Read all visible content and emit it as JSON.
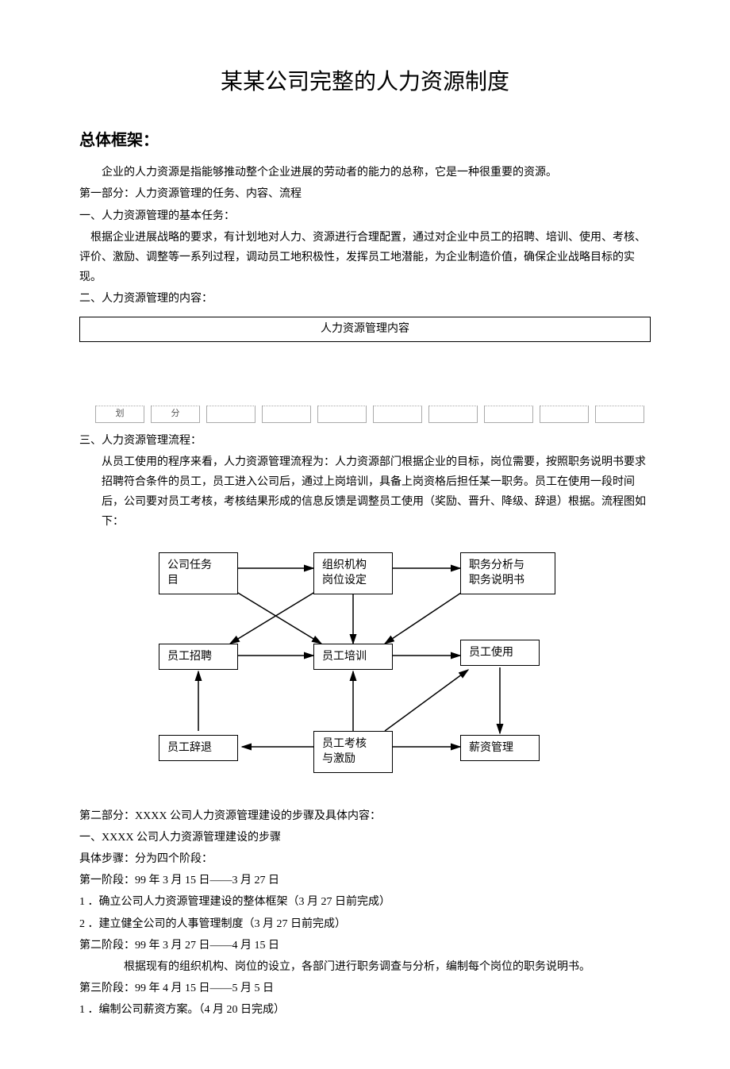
{
  "title": "某某公司完整的人力资源制度",
  "h_framework": "总体框架：",
  "intro": "企业的人力资源是指能够推动整个企业进展的劳动者的能力的总称，它是一种很重要的资源。",
  "part1": "第一部分：人力资源管理的任务、内容、流程",
  "sec1": "一、人力资源管理的基本任务：",
  "sec1_body": "根据企业进展战略的要求，有计划地对人力、资源进行合理配置，通过对企业中员工的招聘、培训、使用、考核、评价、激励、调整等一系列过程，调动员工地积极性，发挥员工地潜能，为企业制造价值，确保企业战略目标的实现。",
  "sec2": "二、人力资源管理的内容：",
  "table_header": "人力资源管理内容",
  "small_boxes": [
    "划",
    "分",
    "",
    "",
    "",
    "",
    "",
    "",
    "",
    ""
  ],
  "sec3": "三、人力资源管理流程：",
  "sec3_p1": "从员工使用的程序来看，人力资源管理流程为：人力资源部门根据企业的目标，岗位需要，按照职务说明书要求招聘符合条件的员工，员工进入公司后，通过上岗培训，具备上岗资格后担任某一职务。员工在使用一段时间后，公司要对员工考核，考核结果形成的信息反馈是调整员工使用（奖励、晋升、降级、辞退）根据。流程图如下：",
  "flow": {
    "b1": "公司任务\n目",
    "b2": "组织机构\n岗位设定",
    "b3": "职务分析与\n职务说明书",
    "b4": "员工招聘",
    "b5": "员工培训",
    "b6": "员工使用",
    "b7": "员工辞退",
    "b8": "员工考核\n与激励",
    "b9": "薪资管理"
  },
  "part2": "第二部分：XXXX 公司人力资源管理建设的步骤及具体内容：",
  "p2_sec1": "一、XXXX 公司人力资源管理建设的步骤",
  "p2_steps_intro": "具体步骤：分为四个阶段：",
  "phase1": "第一阶段：99 年 3 月 15 日——3 月 27 日",
  "phase1_1": "1 ．确立公司人力资源管理建设的整体框架（3 月 27 日前完成）",
  "phase1_2": "2 ．建立健全公司的人事管理制度（3 月 27 日前完成）",
  "phase2": "第二阶段：99 年 3 月 27 日——4 月 15 日",
  "phase2_body": "根据现有的组织机构、岗位的设立，各部门进行职务调查与分析，编制每个岗位的职务说明书。",
  "phase3": "第三阶段：99 年 4 月 15 日——5 月 5 日",
  "phase3_1": "1 ．编制公司薪资方案。（4 月 20 日完成）"
}
